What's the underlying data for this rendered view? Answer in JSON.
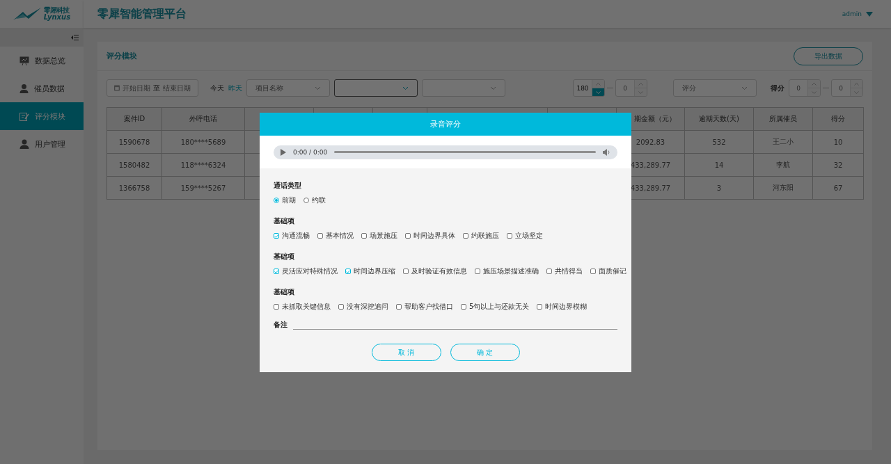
{
  "brand": {
    "name": "零犀科技",
    "latin": "Lynxus"
  },
  "header": {
    "title": "零犀智能管理平台",
    "user": "admin"
  },
  "sidebar": {
    "items": [
      {
        "label": "数据总览",
        "selected": false
      },
      {
        "label": "催员数据",
        "selected": false
      },
      {
        "label": "评分模块",
        "selected": true
      },
      {
        "label": "用户管理",
        "selected": false
      }
    ]
  },
  "card": {
    "title": "评分模块",
    "export_button": "导出数据"
  },
  "filters": {
    "date_range": {
      "start_placeholder": "开始日期",
      "separator": "至",
      "end_placeholder": "结束日期"
    },
    "quick_dates": [
      {
        "label": "今天",
        "selected": false
      },
      {
        "label": "昨天",
        "selected": true
      }
    ],
    "selects": [
      {
        "placeholder": "项目名称",
        "focused": false
      },
      {
        "focused": true
      },
      {
        "focused": false
      }
    ],
    "day_range": {
      "min": {
        "value": "180",
        "down_pressed": true
      },
      "max": {
        "placeholder": "0"
      }
    },
    "rating_select": {
      "placeholder": "评分",
      "focused": false
    },
    "score_range": {
      "label": "得分",
      "min": {
        "placeholder": "0"
      },
      "max": {
        "placeholder": "0"
      }
    }
  },
  "table": {
    "columns": [
      "案件ID",
      "外呼电话",
      null,
      null,
      null,
      null,
      null,
      "期金额（元）",
      "逾期天数(天)",
      "所属催员",
      "得分"
    ],
    "rows": [
      [
        "1590678",
        "180****5689",
        null,
        null,
        null,
        null,
        null,
        "2092.83",
        "532",
        "王二小",
        "10"
      ],
      [
        "1580482",
        "118****6324",
        null,
        null,
        null,
        null,
        null,
        "433,289.77",
        "14",
        "李航",
        "32"
      ],
      [
        "1366758",
        "159****5267",
        null,
        null,
        null,
        null,
        null,
        "433,289.77",
        "3",
        "河东阳",
        "67"
      ]
    ]
  },
  "dialog": {
    "title": "录音评分",
    "audio": {
      "time": "0:00 / 0:00"
    },
    "call_type": {
      "label": "通话类型",
      "options": [
        {
          "label": "前期",
          "selected": true
        },
        {
          "label": "约联",
          "selected": false
        }
      ]
    },
    "groups": [
      {
        "label": "基础项",
        "items": [
          {
            "label": "沟通流畅",
            "checked": true
          },
          {
            "label": "基本情况",
            "checked": false
          },
          {
            "label": "场景施压",
            "checked": false
          },
          {
            "label": "时间边界具体",
            "checked": false
          },
          {
            "label": "约联施压",
            "checked": false
          },
          {
            "label": "立场坚定",
            "checked": false
          }
        ]
      },
      {
        "label": "基础项",
        "items": [
          {
            "label": "灵活应对特殊情况",
            "checked": true
          },
          {
            "label": "时间边界压缩",
            "checked": true
          },
          {
            "label": "及时验证有效信息",
            "checked": false
          },
          {
            "label": "施压场景描述准确",
            "checked": false
          },
          {
            "label": "共情得当",
            "checked": false
          },
          {
            "label": "面质催记",
            "checked": false
          }
        ]
      },
      {
        "label": "基础项",
        "items": [
          {
            "label": "未抓取关键信息",
            "checked": false
          },
          {
            "label": "没有深挖追问",
            "checked": false
          },
          {
            "label": "帮助客户找借口",
            "checked": false
          },
          {
            "label": "5句以上与还款无关",
            "checked": false
          },
          {
            "label": "时间边界模糊",
            "checked": false
          }
        ]
      }
    ],
    "note": {
      "label": "备注"
    },
    "buttons": [
      "取 消",
      "确 定"
    ]
  }
}
